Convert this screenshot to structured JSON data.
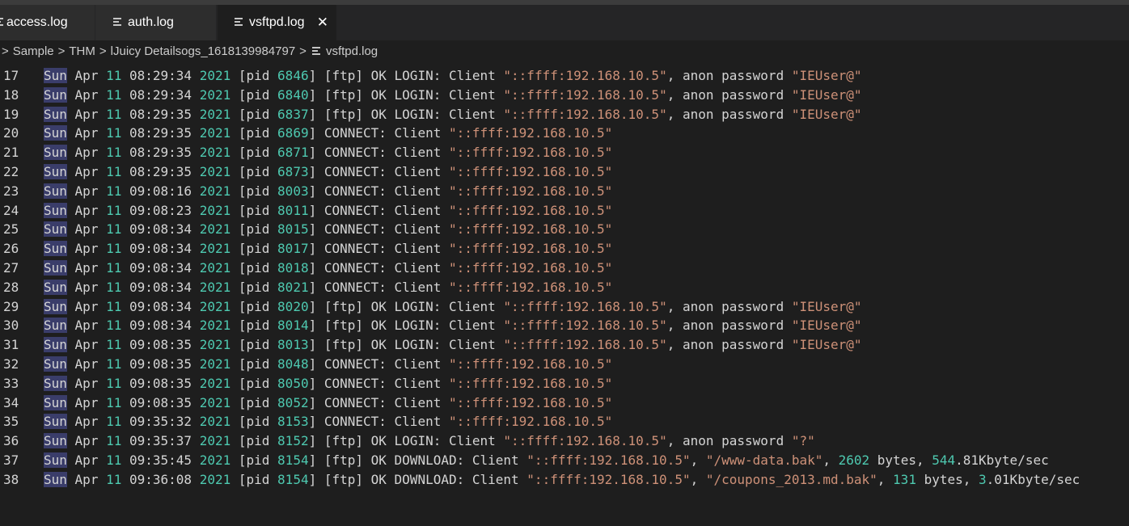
{
  "tabs": [
    {
      "label": "access.log",
      "active": false
    },
    {
      "label": "auth.log",
      "active": false
    },
    {
      "label": "vsftpd.log",
      "active": true,
      "close": "✕"
    }
  ],
  "breadcrumb": {
    "items": [
      "Sample",
      "THM",
      "lJuicy Detailsogs_1618139984797",
      "vsftpd.log"
    ],
    "separator": ">"
  },
  "colors": {
    "background": "#1e1e1e",
    "number": "#4ec9b0",
    "string": "#ce9178",
    "day_highlight": "#3a3d6a"
  },
  "lines": [
    {
      "n": "17",
      "mon": "Apr",
      "d": "11",
      "t": "08:29:34",
      "y": "2021",
      "pid": "6846",
      "msg": "[ftp] OK LOGIN: Client ",
      "ip": "\"::ffff:192.168.10.5\"",
      "rest": ", anon password ",
      "pw": "\"IEUser@\""
    },
    {
      "n": "18",
      "mon": "Apr",
      "d": "11",
      "t": "08:29:34",
      "y": "2021",
      "pid": "6840",
      "msg": "[ftp] OK LOGIN: Client ",
      "ip": "\"::ffff:192.168.10.5\"",
      "rest": ", anon password ",
      "pw": "\"IEUser@\""
    },
    {
      "n": "19",
      "mon": "Apr",
      "d": "11",
      "t": "08:29:35",
      "y": "2021",
      "pid": "6837",
      "msg": "[ftp] OK LOGIN: Client ",
      "ip": "\"::ffff:192.168.10.5\"",
      "rest": ", anon password ",
      "pw": "\"IEUser@\""
    },
    {
      "n": "20",
      "mon": "Apr",
      "d": "11",
      "t": "08:29:35",
      "y": "2021",
      "pid": "6869",
      "msg": "CONNECT: Client ",
      "ip": "\"::ffff:192.168.10.5\""
    },
    {
      "n": "21",
      "mon": "Apr",
      "d": "11",
      "t": "08:29:35",
      "y": "2021",
      "pid": "6871",
      "msg": "CONNECT: Client ",
      "ip": "\"::ffff:192.168.10.5\""
    },
    {
      "n": "22",
      "mon": "Apr",
      "d": "11",
      "t": "08:29:35",
      "y": "2021",
      "pid": "6873",
      "msg": "CONNECT: Client ",
      "ip": "\"::ffff:192.168.10.5\""
    },
    {
      "n": "23",
      "mon": "Apr",
      "d": "11",
      "t": "09:08:16",
      "y": "2021",
      "pid": "8003",
      "msg": "CONNECT: Client ",
      "ip": "\"::ffff:192.168.10.5\""
    },
    {
      "n": "24",
      "mon": "Apr",
      "d": "11",
      "t": "09:08:23",
      "y": "2021",
      "pid": "8011",
      "msg": "CONNECT: Client ",
      "ip": "\"::ffff:192.168.10.5\""
    },
    {
      "n": "25",
      "mon": "Apr",
      "d": "11",
      "t": "09:08:34",
      "y": "2021",
      "pid": "8015",
      "msg": "CONNECT: Client ",
      "ip": "\"::ffff:192.168.10.5\""
    },
    {
      "n": "26",
      "mon": "Apr",
      "d": "11",
      "t": "09:08:34",
      "y": "2021",
      "pid": "8017",
      "msg": "CONNECT: Client ",
      "ip": "\"::ffff:192.168.10.5\""
    },
    {
      "n": "27",
      "mon": "Apr",
      "d": "11",
      "t": "09:08:34",
      "y": "2021",
      "pid": "8018",
      "msg": "CONNECT: Client ",
      "ip": "\"::ffff:192.168.10.5\""
    },
    {
      "n": "28",
      "mon": "Apr",
      "d": "11",
      "t": "09:08:34",
      "y": "2021",
      "pid": "8021",
      "msg": "CONNECT: Client ",
      "ip": "\"::ffff:192.168.10.5\""
    },
    {
      "n": "29",
      "mon": "Apr",
      "d": "11",
      "t": "09:08:34",
      "y": "2021",
      "pid": "8020",
      "msg": "[ftp] OK LOGIN: Client ",
      "ip": "\"::ffff:192.168.10.5\"",
      "rest": ", anon password ",
      "pw": "\"IEUser@\""
    },
    {
      "n": "30",
      "mon": "Apr",
      "d": "11",
      "t": "09:08:34",
      "y": "2021",
      "pid": "8014",
      "msg": "[ftp] OK LOGIN: Client ",
      "ip": "\"::ffff:192.168.10.5\"",
      "rest": ", anon password ",
      "pw": "\"IEUser@\""
    },
    {
      "n": "31",
      "mon": "Apr",
      "d": "11",
      "t": "09:08:35",
      "y": "2021",
      "pid": "8013",
      "msg": "[ftp] OK LOGIN: Client ",
      "ip": "\"::ffff:192.168.10.5\"",
      "rest": ", anon password ",
      "pw": "\"IEUser@\""
    },
    {
      "n": "32",
      "mon": "Apr",
      "d": "11",
      "t": "09:08:35",
      "y": "2021",
      "pid": "8048",
      "msg": "CONNECT: Client ",
      "ip": "\"::ffff:192.168.10.5\""
    },
    {
      "n": "33",
      "mon": "Apr",
      "d": "11",
      "t": "09:08:35",
      "y": "2021",
      "pid": "8050",
      "msg": "CONNECT: Client ",
      "ip": "\"::ffff:192.168.10.5\""
    },
    {
      "n": "34",
      "mon": "Apr",
      "d": "11",
      "t": "09:08:35",
      "y": "2021",
      "pid": "8052",
      "msg": "CONNECT: Client ",
      "ip": "\"::ffff:192.168.10.5\""
    },
    {
      "n": "35",
      "mon": "Apr",
      "d": "11",
      "t": "09:35:32",
      "y": "2021",
      "pid": "8153",
      "msg": "CONNECT: Client ",
      "ip": "\"::ffff:192.168.10.5\""
    },
    {
      "n": "36",
      "mon": "Apr",
      "d": "11",
      "t": "09:35:37",
      "y": "2021",
      "pid": "8152",
      "msg": "[ftp] OK LOGIN: Client ",
      "ip": "\"::ffff:192.168.10.5\"",
      "rest": ", anon password ",
      "pw": "\"?\""
    },
    {
      "n": "37",
      "mon": "Apr",
      "d": "11",
      "t": "09:35:45",
      "y": "2021",
      "pid": "8154",
      "msg": "[ftp] OK DOWNLOAD: Client ",
      "ip": "\"::ffff:192.168.10.5\"",
      "rest": ", ",
      "file": "\"/www-data.bak\"",
      "tail": ", ",
      "bytes": "2602",
      "bl": " bytes, ",
      "r1": "544",
      "r2": ".81Kbyte/sec"
    },
    {
      "n": "38",
      "mon": "Apr",
      "d": "11",
      "t": "09:36:08",
      "y": "2021",
      "pid": "8154",
      "msg": "[ftp] OK DOWNLOAD: Client ",
      "ip": "\"::ffff:192.168.10.5\"",
      "rest": ", ",
      "file": "\"/coupons_2013.md.bak\"",
      "tail": ", ",
      "bytes": "131",
      "bl": " bytes, ",
      "r1": "3",
      "r2": ".01Kbyte/sec"
    }
  ],
  "day_label": "Sun",
  "pid_label": "[pid "
}
